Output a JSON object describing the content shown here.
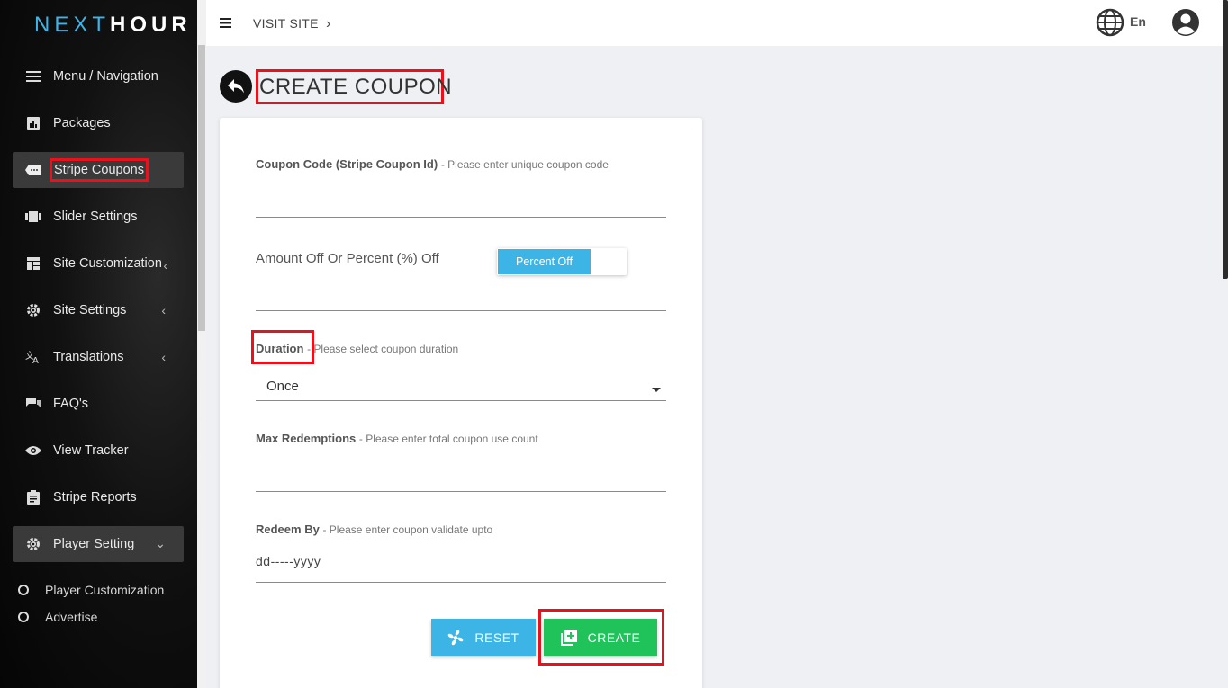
{
  "brand": {
    "part1": "NEXT",
    "part2": "HOUR",
    "mark": "■"
  },
  "sidebar": {
    "items": [
      {
        "label": "Menu / Navigation",
        "icon": "hamburger-icon"
      },
      {
        "label": "Packages",
        "icon": "bar-chart-icon"
      },
      {
        "label": "Stripe Coupons",
        "icon": "coupon-icon"
      },
      {
        "label": "Slider Settings",
        "icon": "slider-icon"
      },
      {
        "label": "Site Customization",
        "icon": "layout-icon",
        "chevron": "‹"
      },
      {
        "label": "Site Settings",
        "icon": "gear-icon",
        "chevron": "‹"
      },
      {
        "label": "Translations",
        "icon": "translate-icon",
        "chevron": "‹"
      },
      {
        "label": "FAQ's",
        "icon": "chat-icon"
      },
      {
        "label": "View Tracker",
        "icon": "eye-icon"
      },
      {
        "label": "Stripe Reports",
        "icon": "clipboard-icon"
      },
      {
        "label": "Player Setting",
        "icon": "gear-icon",
        "chevron": "⌄"
      }
    ],
    "sub_items": [
      {
        "label": "Player Customization"
      },
      {
        "label": "Advertise"
      }
    ]
  },
  "topbar": {
    "visit_site": "VISIT SITE",
    "visit_chevron": "›",
    "language": "En"
  },
  "page": {
    "title": "CREATE COUPON"
  },
  "form": {
    "coupon_code": {
      "label": "Coupon Code (Stripe Coupon Id)",
      "hint": "- Please enter unique coupon code"
    },
    "amount": {
      "label": "Amount Off Or Percent (%) Off",
      "toggle_label": "Percent Off"
    },
    "duration": {
      "label": "Duration",
      "hint": "- Please select coupon duration",
      "value": "Once"
    },
    "max_redemptions": {
      "label": "Max Redemptions",
      "hint": "- Please enter total coupon use count"
    },
    "redeem_by": {
      "label": "Redeem By",
      "hint": "- Please enter coupon validate upto",
      "value": "dd-----yyyy"
    },
    "reset_label": "RESET",
    "create_label": "CREATE"
  },
  "colors": {
    "accent": "#3db4e6",
    "success": "#1fc35a",
    "highlight": "#e8121d"
  }
}
